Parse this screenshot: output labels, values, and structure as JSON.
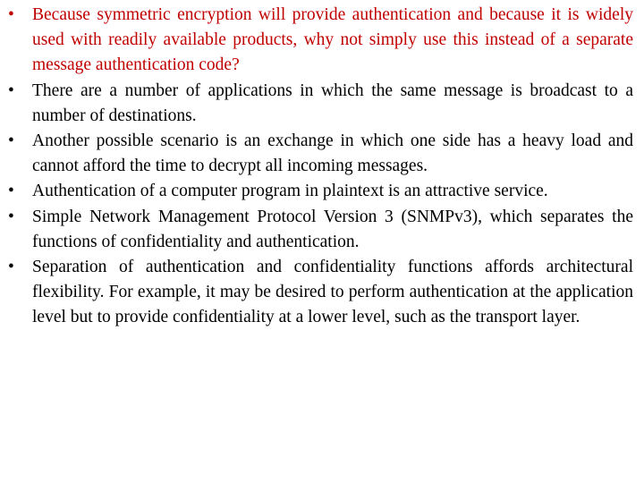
{
  "slide": {
    "accent_color": "#c00000",
    "text_color": "#000000",
    "bullet_glyph": "•",
    "items": [
      {
        "text": "Because symmetric encryption will provide authentication and because it is widely used with readily available products, why not simply use this instead of a separate message authentication code?",
        "highlighted": true
      },
      {
        "text": "There are a number of applications in which the same message is broadcast to a number of destinations.",
        "highlighted": false
      },
      {
        "text": "Another possible scenario is an exchange in which one side has a heavy load and cannot afford the time to decrypt all incoming messages.",
        "highlighted": false
      },
      {
        "text": "Authentication of a computer program in plaintext is an attractive service.",
        "highlighted": false
      },
      {
        "text": "Simple Network Management Protocol Version 3 (SNMPv3), which separates the functions of confidentiality and authentication.",
        "highlighted": false
      },
      {
        "text": "Separation of authentication and confidentiality functions affords architectural flexibility. For example, it may be desired to perform authentication at the application level but to provide confidentiality at a lower level, such as the transport layer.",
        "highlighted": false
      }
    ]
  }
}
